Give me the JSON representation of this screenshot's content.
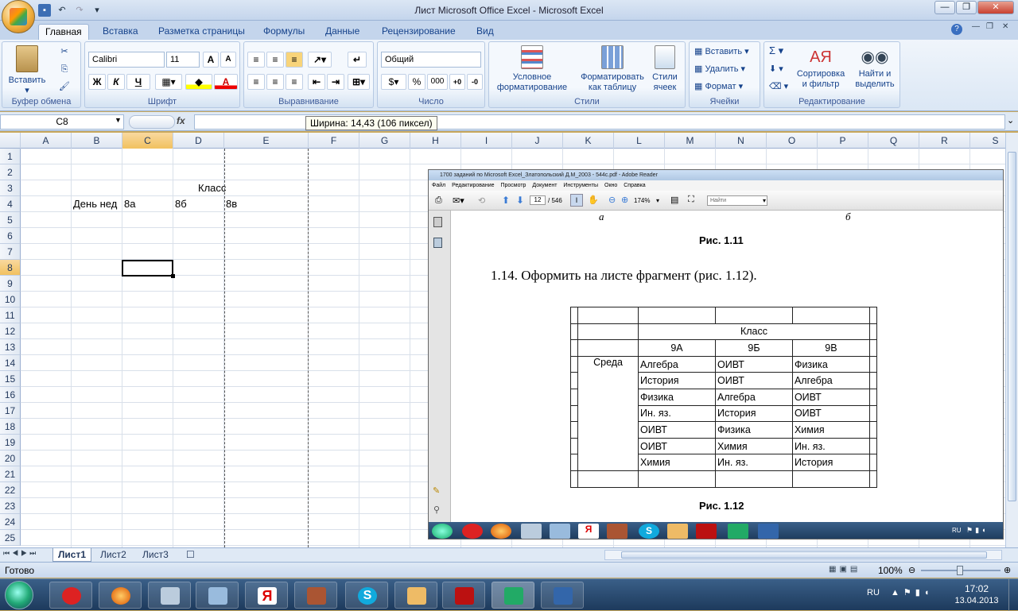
{
  "window": {
    "title": "Лист Microsoft Office Excel - Microsoft Excel"
  },
  "ribbon": {
    "tabs": [
      "Главная",
      "Вставка",
      "Разметка страницы",
      "Формулы",
      "Данные",
      "Рецензирование",
      "Вид"
    ],
    "clipboard": {
      "paste": "Вставить",
      "label": "Буфер обмена"
    },
    "font": {
      "name": "Calibri",
      "size": "11",
      "bold": "Ж",
      "italic": "К",
      "underline": "Ч",
      "label": "Шрифт"
    },
    "alignment": {
      "label": "Выравнивание"
    },
    "number": {
      "format": "Общий",
      "percent": "%",
      "thousands": "000",
      "label": "Число"
    },
    "styles": {
      "conditional_1": "Условное",
      "conditional_2": "форматирование",
      "table_1": "Форматировать",
      "table_2": "как таблицу",
      "cell_1": "Стили",
      "cell_2": "ячеек",
      "label": "Стили"
    },
    "cells": {
      "insert": "Вставить",
      "delete": "Удалить",
      "format": "Формат",
      "label": "Ячейки"
    },
    "editing": {
      "sort_1": "Сортировка",
      "sort_2": "и фильтр",
      "find_1": "Найти и",
      "find_2": "выделить",
      "label": "Редактирование"
    }
  },
  "formula_bar": {
    "name_box": "C8",
    "fx": "fx",
    "tooltip": "Ширина: 14,43 (106 пиксел)"
  },
  "sheet": {
    "columns": [
      "A",
      "B",
      "C",
      "D",
      "E",
      "F",
      "G",
      "H",
      "I",
      "J",
      "K",
      "L",
      "M",
      "N",
      "O",
      "P",
      "Q",
      "R",
      "S"
    ],
    "rows": [
      "1",
      "2",
      "3",
      "4",
      "5",
      "6",
      "7",
      "8",
      "9",
      "10",
      "11",
      "12",
      "13",
      "14",
      "15",
      "16",
      "17",
      "18",
      "19",
      "20",
      "21",
      "22",
      "23",
      "24",
      "25"
    ],
    "cells": {
      "d3": "Класс",
      "b4": "День нед",
      "c4": "8а",
      "d4": "8б",
      "e4": "8в"
    }
  },
  "sheet_tabs": [
    "Лист1",
    "Лист2",
    "Лист3"
  ],
  "status": {
    "ready": "Готово",
    "zoom": "100%"
  },
  "reader": {
    "title": "1700 заданий по Microsoft Excel_Златопольский Д.М_2003 - 544с.pdf - Adobe Reader",
    "menu": [
      "Файл",
      "Редактирование",
      "Просмотр",
      "Документ",
      "Инструменты",
      "Окно",
      "Справка"
    ],
    "page": "12",
    "pages": "/ 546",
    "zoom": "174%",
    "find": "Найти",
    "fig_a": "а",
    "fig_b": "б",
    "caption_top": "Рис.  1.11",
    "task": "1.14. Оформить на листе фрагмент (рис. 1.12).",
    "caption_bottom": "Рис.  1.12",
    "table": {
      "header": "Класс",
      "classes": [
        "9А",
        "9Б",
        "9В"
      ],
      "day": "Среда",
      "rows": [
        [
          "Алгебра",
          "ОИВТ",
          "Физика"
        ],
        [
          "История",
          "ОИВТ",
          "Алгебра"
        ],
        [
          "Физика",
          "Алгебра",
          "ОИВТ"
        ],
        [
          "Ин. яз.",
          "История",
          "ОИВТ"
        ],
        [
          "ОИВТ",
          "Физика",
          "Химия"
        ],
        [
          "ОИВТ",
          "Химия",
          "Ин. яз."
        ],
        [
          "Химия",
          "Ин. яз.",
          "История"
        ]
      ]
    },
    "tray_lang": "RU"
  },
  "taskbar": {
    "lang": "RU",
    "time": "17:02",
    "date": "13.04.2013"
  }
}
